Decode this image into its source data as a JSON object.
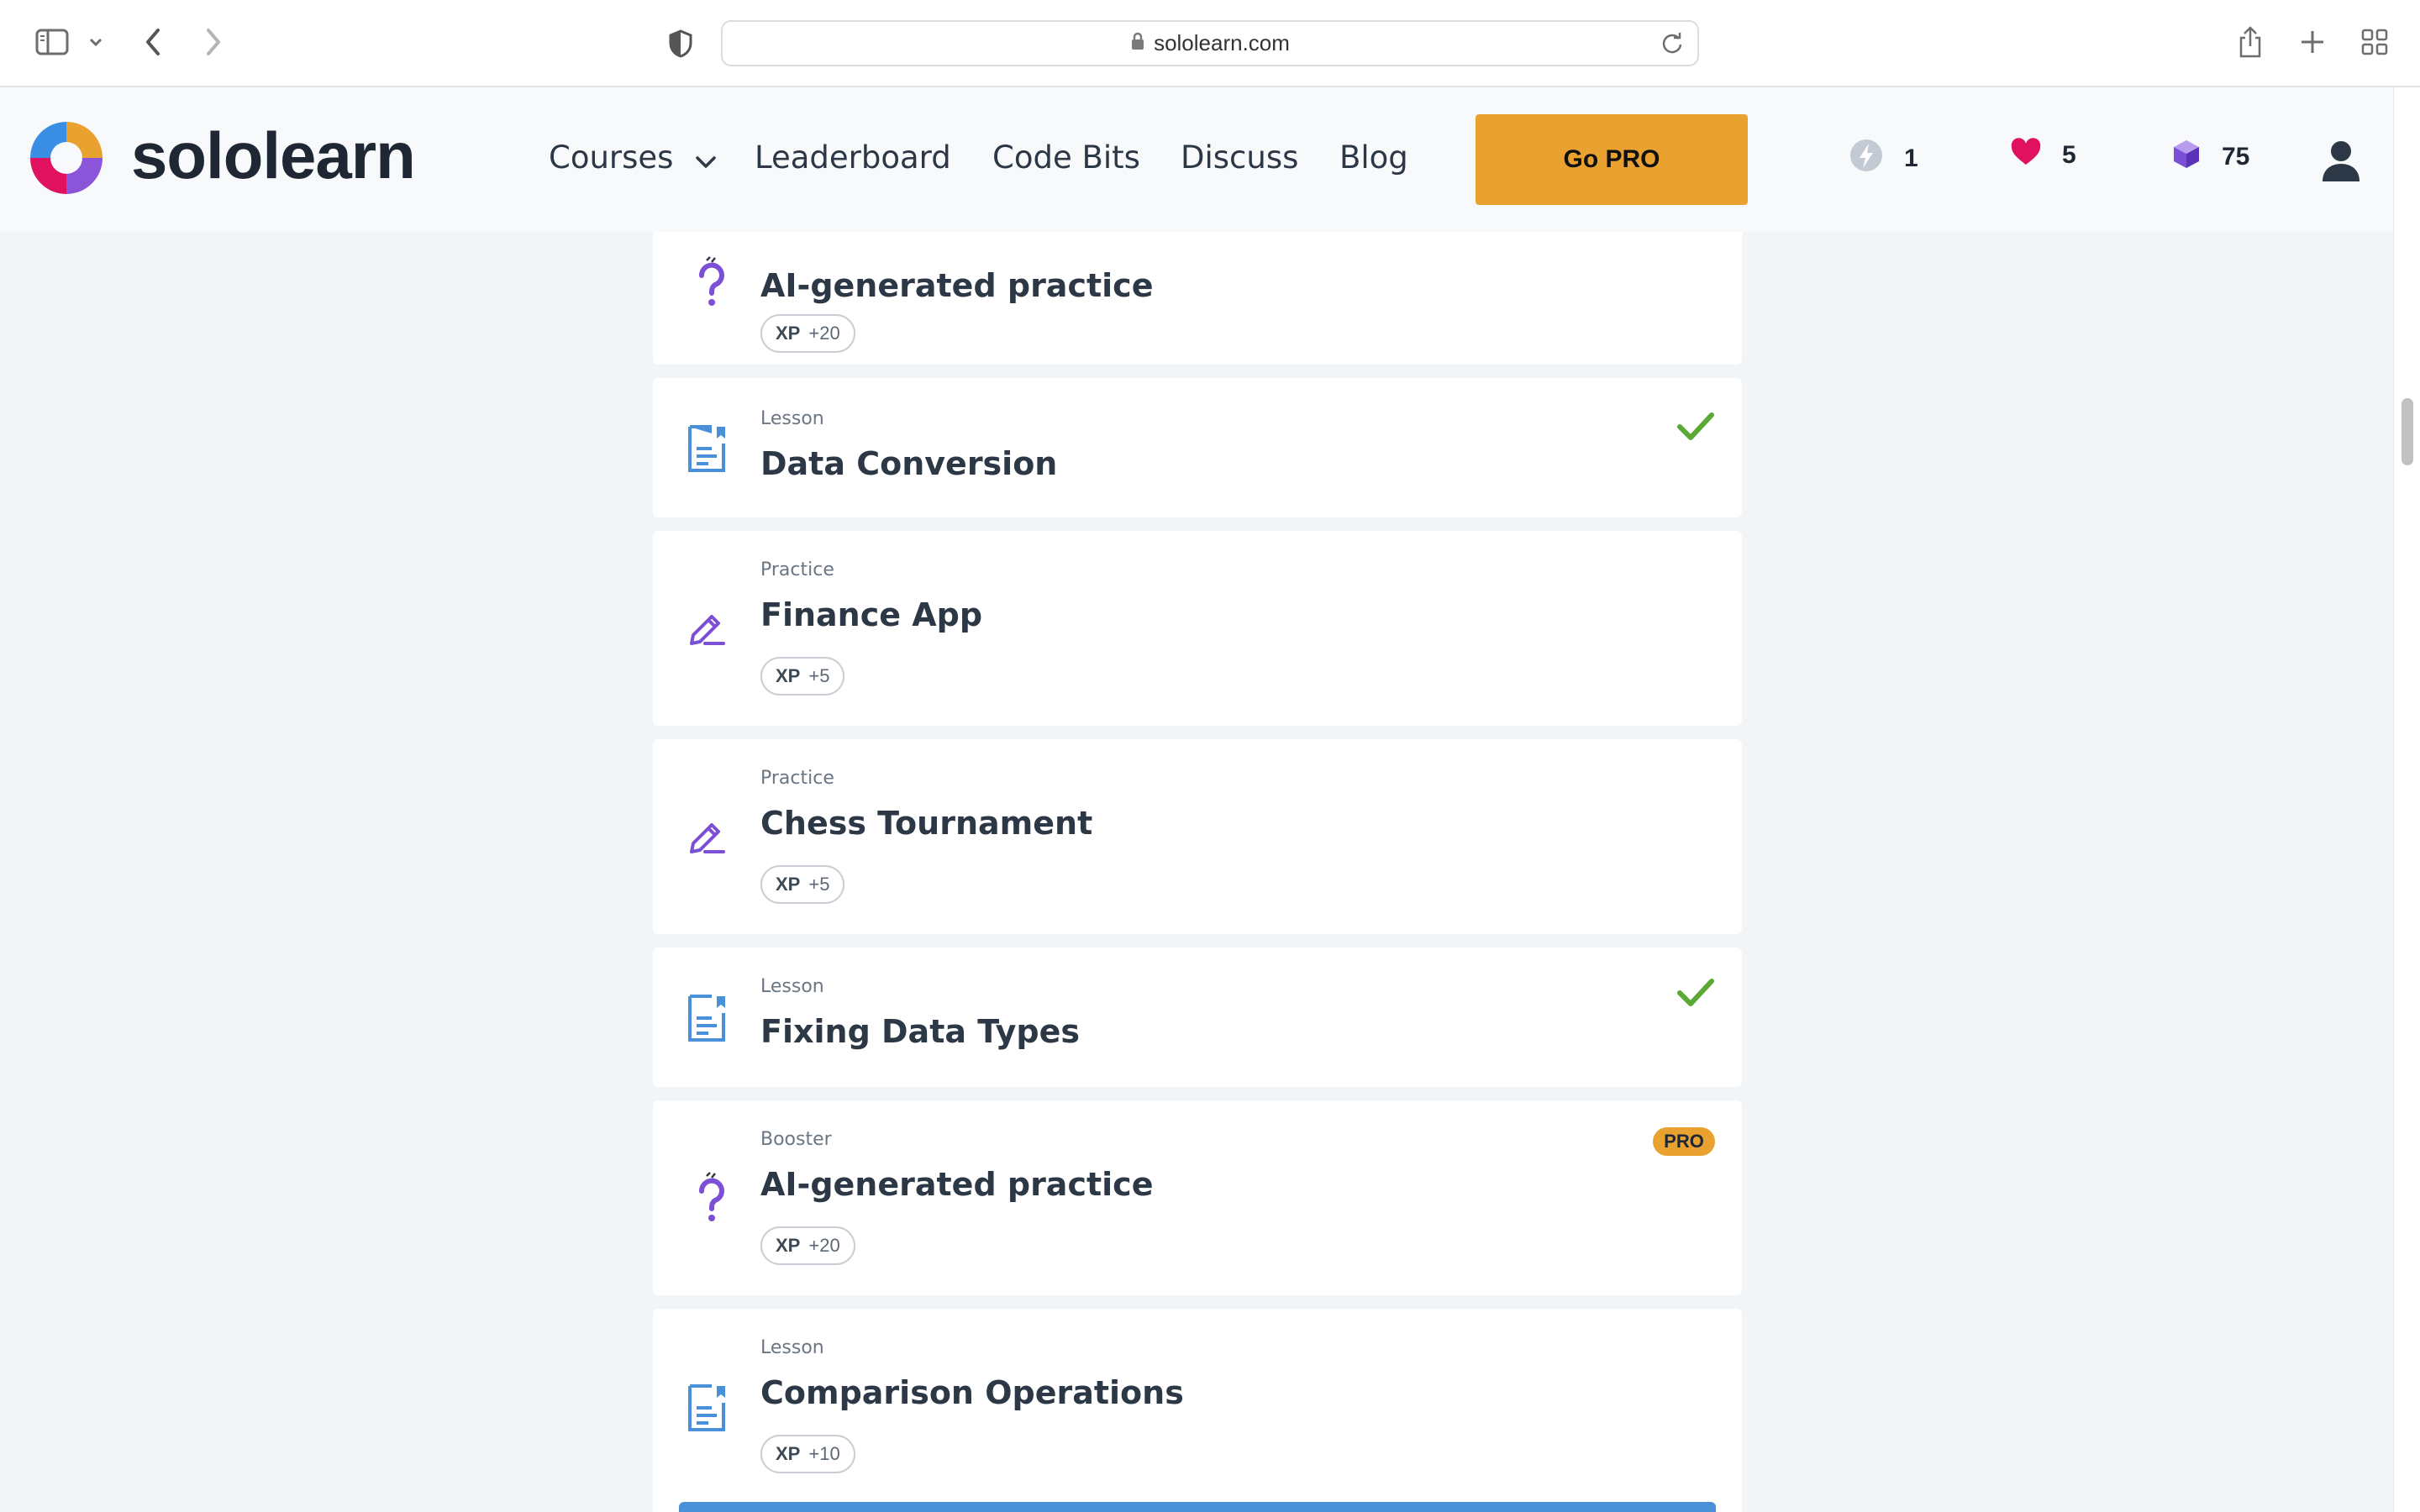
{
  "browser": {
    "url": "sololearn.com"
  },
  "header": {
    "brand": "sololearn",
    "nav": {
      "courses": "Courses",
      "leaderboard": "Leaderboard",
      "code_bits": "Code Bits",
      "discuss": "Discuss",
      "blog": "Blog"
    },
    "go_pro": "Go PRO",
    "stats": {
      "streak": "1",
      "hearts": "5",
      "gems": "75"
    }
  },
  "lessons": [
    {
      "type": "",
      "title": "AI-generated practice",
      "xp_label": "XP",
      "xp": "+20",
      "icon": "ai-question-icon",
      "completed": false,
      "pro": false
    },
    {
      "type": "Lesson",
      "title": "Data Conversion",
      "icon": "lesson-document-icon",
      "completed": true,
      "pro": false
    },
    {
      "type": "Practice",
      "title": "Finance App",
      "xp_label": "XP",
      "xp": "+5",
      "icon": "practice-pencil-icon",
      "completed": false,
      "pro": false
    },
    {
      "type": "Practice",
      "title": "Chess Tournament",
      "xp_label": "XP",
      "xp": "+5",
      "icon": "practice-pencil-icon",
      "completed": false,
      "pro": false
    },
    {
      "type": "Lesson",
      "title": "Fixing Data Types",
      "icon": "lesson-document-icon",
      "completed": true,
      "pro": false
    },
    {
      "type": "Booster",
      "title": "AI-generated practice",
      "xp_label": "XP",
      "xp": "+20",
      "icon": "ai-question-icon",
      "completed": false,
      "pro": true,
      "pro_label": "PRO"
    },
    {
      "type": "Lesson",
      "title": "Comparison Operations",
      "xp_label": "XP",
      "xp": "+10",
      "icon": "lesson-document-icon",
      "completed": false,
      "pro": false
    }
  ],
  "colors": {
    "accent_orange": "#e9a230",
    "check_green": "#5aa935",
    "lesson_blue": "#4a90d9",
    "practice_purple": "#7b4fd6",
    "heart_red": "#e0115f"
  }
}
